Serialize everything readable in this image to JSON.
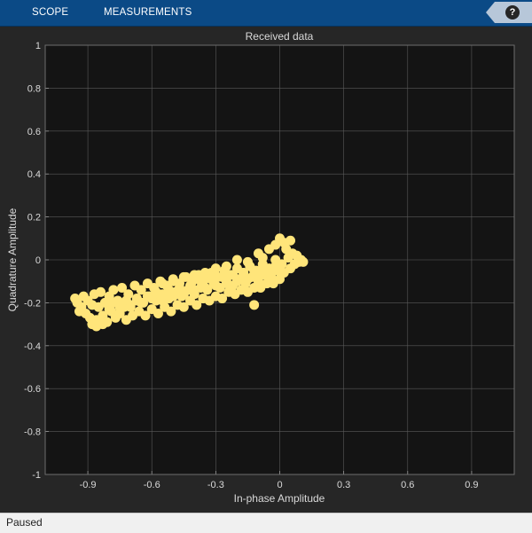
{
  "toolstrip": {
    "tabs": [
      {
        "label": "SCOPE"
      },
      {
        "label": "MEASUREMENTS"
      }
    ],
    "help_label": "?"
  },
  "status": {
    "text": "Paused"
  },
  "colors": {
    "toolstrip": "#0b4a86",
    "figure_background": "#262626",
    "axes_background": "#141414",
    "grid": "#5a5a5a",
    "text": "#d9d9d9",
    "points": "#ffe57a"
  },
  "chart_data": {
    "type": "scatter",
    "title": "Received data",
    "xlabel": "In-phase Amplitude",
    "ylabel": "Quadrature Amplitude",
    "xlim": [
      -1.1,
      1.1
    ],
    "ylim": [
      -1,
      1
    ],
    "xticks": [
      -0.9,
      -0.6,
      -0.3,
      0,
      0.3,
      0.6,
      0.9
    ],
    "yticks": [
      -1,
      -0.8,
      -0.6,
      -0.4,
      -0.2,
      0,
      0.2,
      0.4,
      0.6,
      0.8,
      1
    ],
    "xtick_labels": [
      "-0.9",
      "-0.6",
      "-0.3",
      "0",
      "0.3",
      "0.6",
      "0.9"
    ],
    "ytick_labels": [
      "-1",
      "-0.8",
      "-0.6",
      "-0.4",
      "-0.2",
      "0",
      "0.2",
      "0.4",
      "0.6",
      "0.8",
      "1"
    ],
    "grid": true,
    "legend": false,
    "series": [
      {
        "values": [
          [
            -0.93,
            -0.22
          ],
          [
            -0.92,
            -0.17
          ],
          [
            -0.91,
            -0.25
          ],
          [
            -0.9,
            -0.19
          ],
          [
            -0.89,
            -0.27
          ],
          [
            -0.88,
            -0.21
          ],
          [
            -0.87,
            -0.16
          ],
          [
            -0.86,
            -0.28
          ],
          [
            -0.85,
            -0.22
          ],
          [
            -0.84,
            -0.15
          ],
          [
            -0.83,
            -0.26
          ],
          [
            -0.82,
            -0.2
          ],
          [
            -0.81,
            -0.29
          ],
          [
            -0.8,
            -0.17
          ],
          [
            -0.79,
            -0.24
          ],
          [
            -0.78,
            -0.14
          ],
          [
            -0.77,
            -0.27
          ],
          [
            -0.76,
            -0.19
          ],
          [
            -0.75,
            -0.25
          ],
          [
            -0.74,
            -0.13
          ],
          [
            -0.73,
            -0.22
          ],
          [
            -0.72,
            -0.28
          ],
          [
            -0.71,
            -0.16
          ],
          [
            -0.7,
            -0.21
          ],
          [
            -0.69,
            -0.26
          ],
          [
            -0.68,
            -0.12
          ],
          [
            -0.67,
            -0.19
          ],
          [
            -0.66,
            -0.24
          ],
          [
            -0.65,
            -0.14
          ],
          [
            -0.64,
            -0.2
          ],
          [
            -0.63,
            -0.26
          ],
          [
            -0.62,
            -0.11
          ],
          [
            -0.61,
            -0.17
          ],
          [
            -0.6,
            -0.23
          ],
          [
            -0.59,
            -0.13
          ],
          [
            -0.58,
            -0.19
          ],
          [
            -0.57,
            -0.25
          ],
          [
            -0.56,
            -0.1
          ],
          [
            -0.55,
            -0.16
          ],
          [
            -0.54,
            -0.22
          ],
          [
            -0.53,
            -0.12
          ],
          [
            -0.52,
            -0.18
          ],
          [
            -0.51,
            -0.24
          ],
          [
            -0.5,
            -0.09
          ],
          [
            -0.49,
            -0.15
          ],
          [
            -0.48,
            -0.21
          ],
          [
            -0.47,
            -0.11
          ],
          [
            -0.46,
            -0.17
          ],
          [
            -0.45,
            -0.22
          ],
          [
            -0.44,
            -0.08
          ],
          [
            -0.43,
            -0.14
          ],
          [
            -0.42,
            -0.19
          ],
          [
            -0.41,
            -0.1
          ],
          [
            -0.4,
            -0.16
          ],
          [
            -0.39,
            -0.21
          ],
          [
            -0.38,
            -0.07
          ],
          [
            -0.37,
            -0.13
          ],
          [
            -0.36,
            -0.18
          ],
          [
            -0.35,
            -0.09
          ],
          [
            -0.34,
            -0.14
          ],
          [
            -0.33,
            -0.19
          ],
          [
            -0.32,
            -0.06
          ],
          [
            -0.31,
            -0.11
          ],
          [
            -0.3,
            -0.17
          ],
          [
            -0.29,
            -0.08
          ],
          [
            -0.28,
            -0.13
          ],
          [
            -0.27,
            -0.18
          ],
          [
            -0.26,
            -0.05
          ],
          [
            -0.25,
            -0.1
          ],
          [
            -0.24,
            -0.15
          ],
          [
            -0.23,
            -0.07
          ],
          [
            -0.22,
            -0.12
          ],
          [
            -0.21,
            -0.16
          ],
          [
            -0.2,
            -0.04
          ],
          [
            -0.19,
            -0.09
          ],
          [
            -0.18,
            -0.14
          ],
          [
            -0.17,
            -0.06
          ],
          [
            -0.16,
            -0.11
          ],
          [
            -0.15,
            -0.15
          ],
          [
            -0.14,
            -0.03
          ],
          [
            -0.13,
            -0.08
          ],
          [
            -0.12,
            -0.13
          ],
          [
            -0.11,
            -0.05
          ],
          [
            -0.1,
            -0.1
          ],
          [
            -0.09,
            -0.13
          ],
          [
            -0.08,
            -0.02
          ],
          [
            -0.07,
            -0.07
          ],
          [
            -0.06,
            -0.11
          ],
          [
            -0.05,
            -0.04
          ],
          [
            -0.04,
            -0.08
          ],
          [
            -0.03,
            -0.11
          ],
          [
            -0.02,
            0.0
          ],
          [
            -0.01,
            -0.05
          ],
          [
            0.0,
            -0.09
          ],
          [
            0.01,
            -0.02
          ],
          [
            0.02,
            -0.06
          ],
          [
            0.03,
            0.05
          ],
          [
            0.04,
            0.01
          ],
          [
            0.05,
            -0.04
          ],
          [
            0.06,
            0.03
          ],
          [
            0.07,
            -0.02
          ],
          [
            0.08,
            0.02
          ],
          [
            0.09,
            -0.01
          ],
          [
            0.1,
            0.0
          ],
          [
            -0.6,
            -0.18
          ],
          [
            -0.58,
            -0.15
          ],
          [
            -0.55,
            -0.19
          ],
          [
            -0.52,
            -0.14
          ],
          [
            -0.5,
            -0.17
          ],
          [
            -0.47,
            -0.13
          ],
          [
            -0.45,
            -0.16
          ],
          [
            -0.42,
            -0.12
          ],
          [
            -0.4,
            -0.14
          ],
          [
            -0.37,
            -0.1
          ],
          [
            -0.35,
            -0.13
          ],
          [
            -0.32,
            -0.09
          ],
          [
            -0.3,
            -0.12
          ],
          [
            -0.27,
            -0.08
          ],
          [
            -0.25,
            -0.11
          ],
          [
            -0.22,
            -0.07
          ],
          [
            -0.2,
            -0.1
          ],
          [
            -0.17,
            -0.06
          ],
          [
            -0.15,
            -0.09
          ],
          [
            -0.12,
            -0.05
          ],
          [
            -0.1,
            -0.07
          ],
          [
            -0.07,
            -0.04
          ],
          [
            -0.05,
            -0.06
          ],
          [
            -0.02,
            -0.03
          ],
          [
            -0.8,
            -0.23
          ],
          [
            -0.78,
            -0.2
          ],
          [
            -0.75,
            -0.22
          ],
          [
            -0.72,
            -0.19
          ],
          [
            -0.7,
            -0.22
          ],
          [
            -0.67,
            -0.18
          ],
          [
            -0.65,
            -0.2
          ],
          [
            -0.62,
            -0.17
          ],
          [
            -0.1,
            0.03
          ],
          [
            -0.05,
            0.05
          ],
          [
            -0.02,
            0.07
          ],
          [
            0.02,
            0.08
          ],
          [
            0.05,
            0.09
          ],
          [
            0.0,
            0.1
          ],
          [
            -0.08,
            0.01
          ],
          [
            -0.15,
            -0.01
          ],
          [
            -0.2,
            0.0
          ],
          [
            -0.25,
            -0.03
          ],
          [
            -0.3,
            -0.04
          ],
          [
            -0.35,
            -0.06
          ],
          [
            -0.4,
            -0.07
          ],
          [
            -0.45,
            -0.08
          ],
          [
            -0.5,
            -0.1
          ],
          [
            -0.55,
            -0.11
          ],
          [
            -0.12,
            -0.21
          ],
          [
            -0.95,
            -0.2
          ],
          [
            -0.94,
            -0.24
          ],
          [
            -0.86,
            -0.31
          ],
          [
            -0.88,
            -0.3
          ],
          [
            0.11,
            -0.01
          ],
          [
            -0.96,
            -0.18
          ],
          [
            -0.83,
            -0.3
          ]
        ]
      }
    ]
  }
}
